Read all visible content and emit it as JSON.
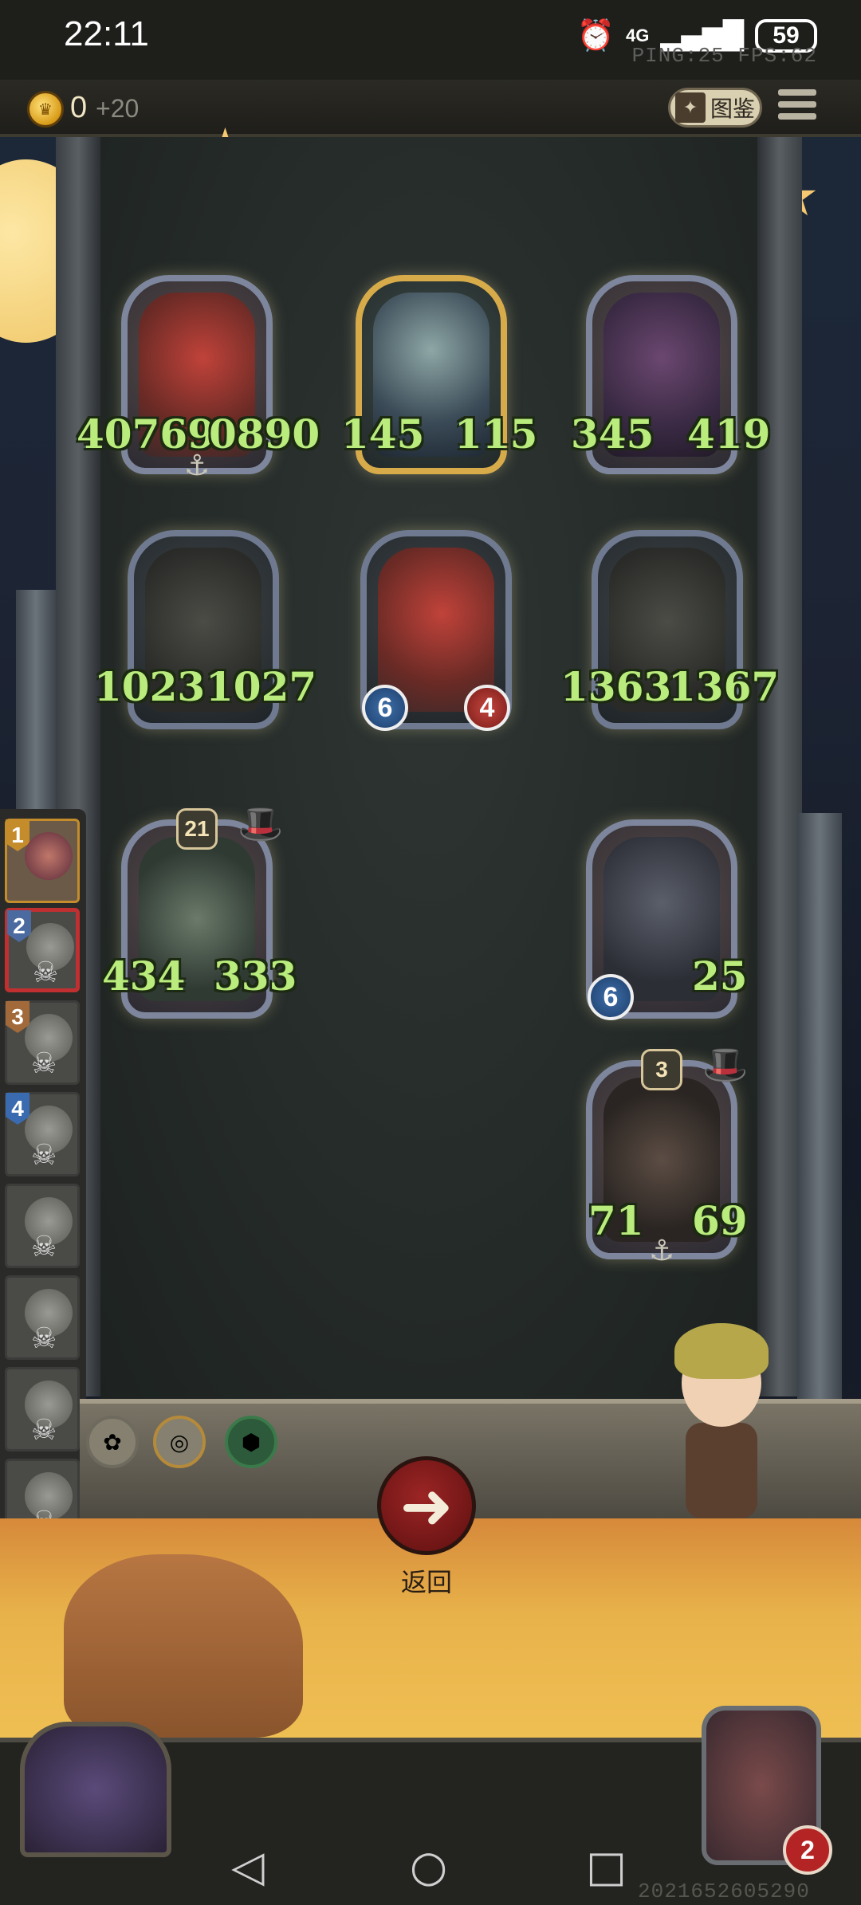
{
  "status": {
    "time": "22:11",
    "network": "4G",
    "battery": "59",
    "perf": "PING:25  FPS:62"
  },
  "hud": {
    "gold": "0",
    "gold_income": "+20",
    "codex_label": "图鉴"
  },
  "board": {
    "minions": [
      {
        "art": "dragon",
        "atk": "40769",
        "hp": "0890"
      },
      {
        "art": "elf",
        "atk": "145",
        "hp": "115"
      },
      {
        "art": "beast",
        "atk": "345",
        "hp": "419"
      },
      {
        "art": "hat-man",
        "atk": "1023",
        "hp": "1027"
      },
      {
        "art": "dragon",
        "atk": "6",
        "hp": "4"
      },
      {
        "art": "hat-man",
        "atk": "1363",
        "hp": "1367"
      },
      {
        "art": "fish",
        "atk": "434",
        "hp": "333",
        "tier": "21"
      },
      {
        "art": "wraith",
        "atk": "6",
        "hp": "25"
      },
      {
        "art": "knight",
        "atk": "71",
        "hp": "69",
        "tier": "3"
      }
    ]
  },
  "players": [
    {
      "rank": "1",
      "rank_color": "#c58c2c"
    },
    {
      "rank": "2",
      "rank_color": "#4a6aa0"
    },
    {
      "rank": "3",
      "rank_color": "#a26a3a"
    },
    {
      "rank": "4",
      "rank_color": "#3a6ab0"
    }
  ],
  "actions": {
    "return_label": "返回"
  },
  "hero": {
    "health": "2"
  },
  "game_id": "2021652605290"
}
